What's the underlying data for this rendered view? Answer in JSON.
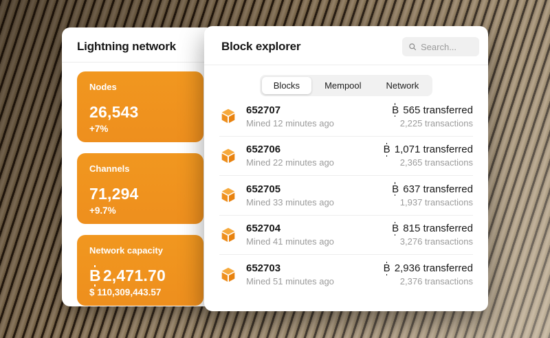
{
  "lightning_panel": {
    "title": "Lightning network",
    "stats": [
      {
        "label": "Nodes",
        "value": "26,543",
        "sub": "+7%"
      },
      {
        "label": "Channels",
        "value": "71,294",
        "sub": "+9.7%"
      },
      {
        "label": "Network capacity",
        "value": "2,471.70",
        "sub": "$ 110,309,443.57"
      }
    ]
  },
  "block_explorer": {
    "title": "Block explorer",
    "search": {
      "placeholder": "Search...",
      "icon": "search-icon"
    },
    "tabs": [
      {
        "label": "Blocks",
        "active": true
      },
      {
        "label": "Mempool",
        "active": false
      },
      {
        "label": "Network",
        "active": false
      }
    ],
    "blocks": [
      {
        "height": "652707",
        "mined": "Mined 12 minutes ago",
        "transferred": "565 transferred",
        "transactions": "2,225 transactions"
      },
      {
        "height": "652706",
        "mined": "Mined 22 minutes ago",
        "transferred": "1,071 transferred",
        "transactions": "2,365 transactions"
      },
      {
        "height": "652705",
        "mined": "Mined 33 minutes ago",
        "transferred": "637 transferred",
        "transactions": "1,937 transactions"
      },
      {
        "height": "652704",
        "mined": "Mined 41 minutes ago",
        "transferred": "815 transferred",
        "transactions": "3,276 transactions"
      },
      {
        "height": "652703",
        "mined": "Mined 51 minutes ago",
        "transferred": "2,936 transferred",
        "transactions": "2,376 transactions"
      }
    ]
  },
  "symbols": {
    "bitcoin_sign": "B"
  },
  "colors": {
    "accent_orange": "#EF921E",
    "text_dark": "#161616",
    "text_gray": "#9B9B9B"
  }
}
